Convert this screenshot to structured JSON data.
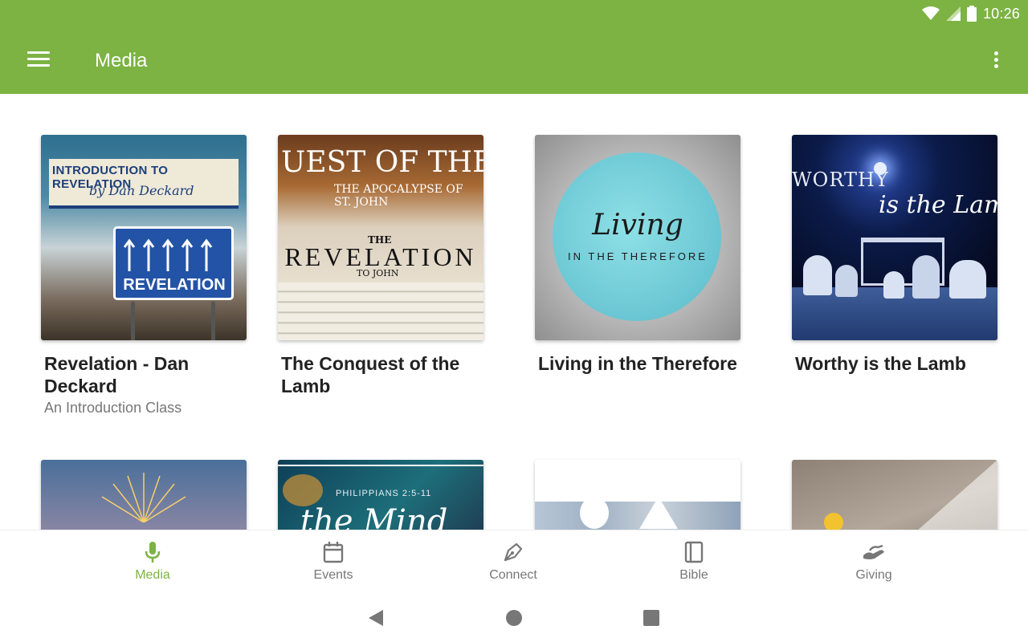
{
  "status": {
    "time": "10:26"
  },
  "appbar": {
    "title": "Media"
  },
  "items": [
    {
      "title": "Revelation - Dan Deckard",
      "subtitle": "An Introduction Class",
      "art": {
        "line1": "INTRODUCTION TO REVELATION",
        "line2": "by Dan Deckard",
        "sign": "REVELATION"
      }
    },
    {
      "title": "The Conquest of the Lamb",
      "subtitle": "",
      "art": {
        "line1": "UEST OF THE LAMB",
        "line2": "THE APOCALYPSE OF ST. JOHN",
        "small": "THE",
        "big": "REVELATION",
        "sub": "TO JOHN"
      }
    },
    {
      "title": "Living in the Therefore",
      "subtitle": "",
      "art": {
        "line1": "Living",
        "line2": "IN THE THEREFORE"
      }
    },
    {
      "title": "Worthy is the Lamb",
      "subtitle": "",
      "art": {
        "line1": "WORTHY",
        "line2": "is the Lamb"
      }
    },
    {
      "title": "",
      "subtitle": "",
      "art": {
        "line1": ""
      }
    },
    {
      "title": "",
      "subtitle": "",
      "art": {
        "line1": "PHILIPPIANS 2:5-11",
        "line2": "the Mind"
      }
    },
    {
      "title": "",
      "subtitle": "",
      "art": {
        "line1": ""
      }
    },
    {
      "title": "",
      "subtitle": "",
      "art": {
        "line1": ""
      }
    }
  ],
  "nav": [
    {
      "label": "Media",
      "icon": "microphone-icon"
    },
    {
      "label": "Events",
      "icon": "calendar-icon"
    },
    {
      "label": "Connect",
      "icon": "pen-icon"
    },
    {
      "label": "Bible",
      "icon": "book-icon"
    },
    {
      "label": "Giving",
      "icon": "giving-hand-icon"
    }
  ],
  "colors": {
    "accent": "#7cb342",
    "inactive": "#777777"
  }
}
